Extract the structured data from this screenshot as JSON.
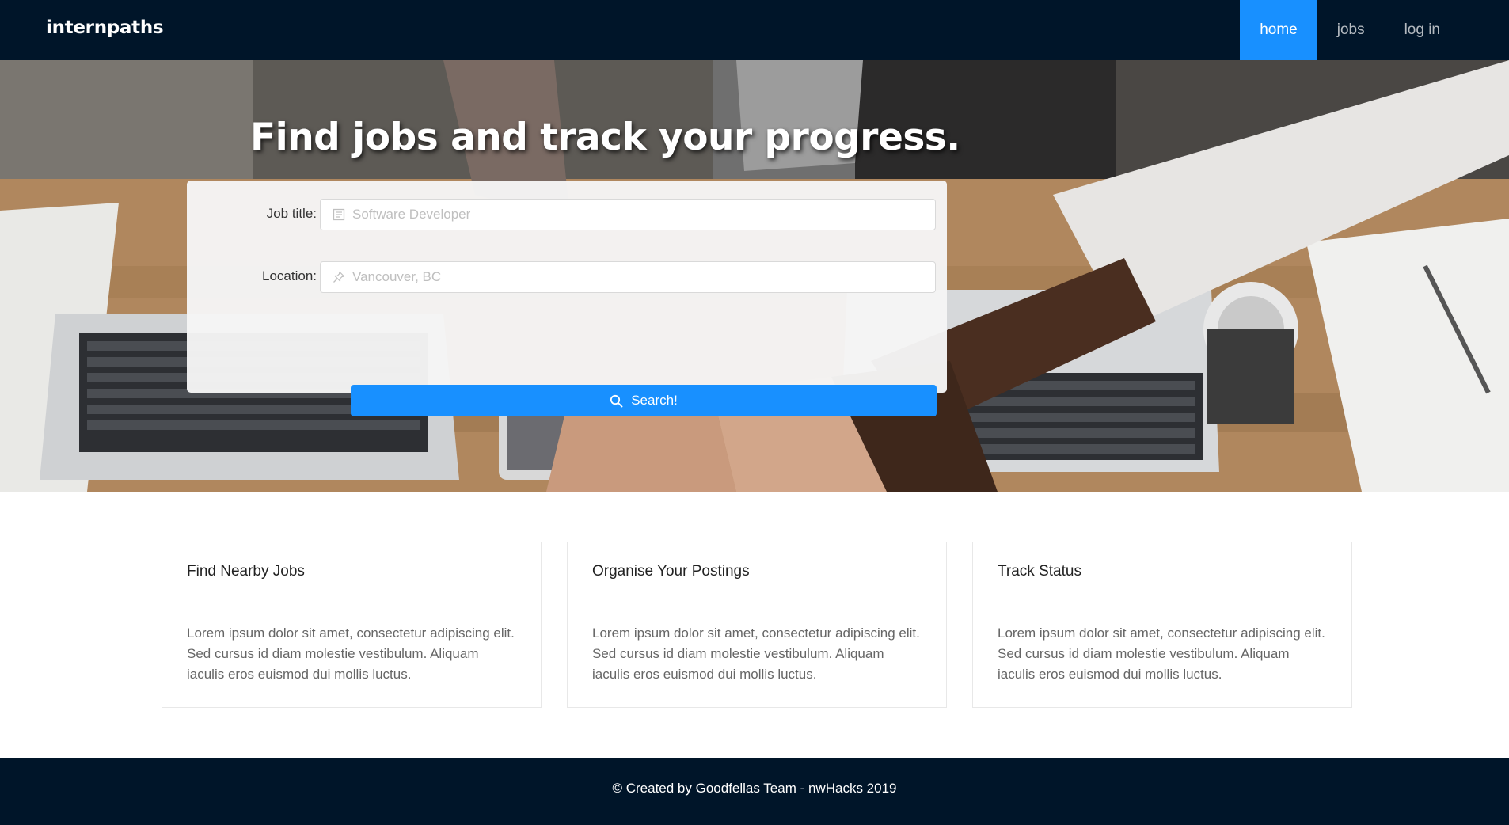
{
  "navbar": {
    "logo": "internpaths",
    "items": [
      {
        "label": "home",
        "active": true
      },
      {
        "label": "jobs",
        "active": false
      },
      {
        "label": "log in",
        "active": false
      }
    ],
    "bg_color": "#001529",
    "accent_color": "#1890ff"
  },
  "hero": {
    "title": "Find jobs and track your progress.",
    "form": {
      "job_title_label": "Job title:",
      "job_title_placeholder": "Software Developer",
      "job_title_value": "",
      "job_title_icon": "profile-icon",
      "location_label": "Location:",
      "location_placeholder": "Vancouver, BC",
      "location_value": "",
      "location_icon": "pushpin-icon",
      "search_label": "Search!",
      "search_icon": "search-icon"
    }
  },
  "features": [
    {
      "title": "Find Nearby Jobs",
      "body": "Lorem ipsum dolor sit amet, consectetur adipiscing elit. Sed cursus id diam molestie vestibulum. Aliquam iaculis eros euismod dui mollis luctus."
    },
    {
      "title": "Organise Your Postings",
      "body": "Lorem ipsum dolor sit amet, consectetur adipiscing elit. Sed cursus id diam molestie vestibulum. Aliquam iaculis eros euismod dui mollis luctus."
    },
    {
      "title": "Track Status",
      "body": "Lorem ipsum dolor sit amet, consectetur adipiscing elit. Sed cursus id diam molestie vestibulum. Aliquam iaculis eros euismod dui mollis luctus."
    }
  ],
  "footer": {
    "text": "© Created by Goodfellas Team - nwHacks 2019"
  }
}
